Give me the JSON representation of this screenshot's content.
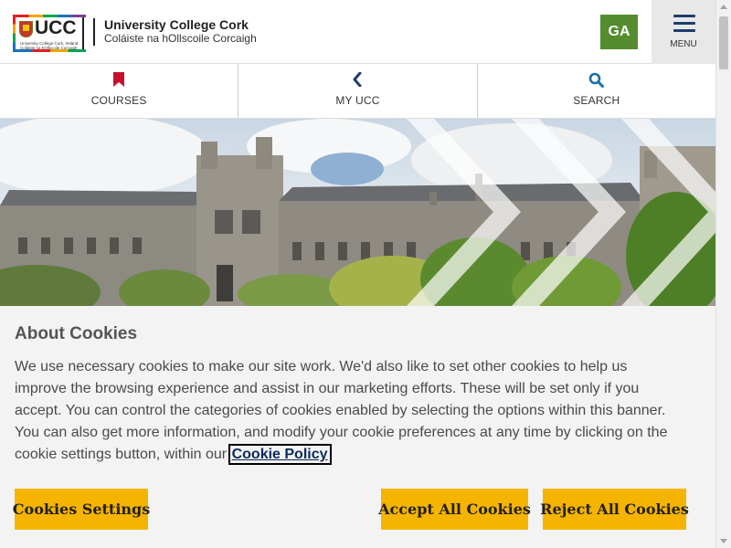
{
  "header": {
    "logo_text": "UCC",
    "logo_small_line1": "University College Cork, Ireland",
    "logo_small_line2": "Coláiste na hOllscoile Corcaigh",
    "site_name": "University College Cork",
    "site_name_irish": "Coláiste na hOllscoile Corcaigh",
    "language_button": "GA",
    "menu_label": "MENU"
  },
  "nav": {
    "items": [
      {
        "label": "COURSES",
        "icon": "bookmark-icon",
        "color": "#c8102e"
      },
      {
        "label": "MY UCC",
        "icon": "chevron-left-icon",
        "color": "#1f3c6e"
      },
      {
        "label": "SEARCH",
        "icon": "search-icon",
        "color": "#1d6fa8"
      }
    ]
  },
  "cookie_banner": {
    "title": "About Cookies",
    "body": "We use necessary cookies to make our site work. We'd also like to set other cookies to help us improve the browsing experience and assist in our marketing efforts. These will be set only if you accept. You can control the categories of cookies enabled by selecting the options within this banner. You can also get more information, and modify your cookie preferences at any time by clicking on the cookie settings button, within our",
    "policy_link": "Cookie Policy",
    "settings_button": "Cookies Settings",
    "accept_button": "Accept All Cookies",
    "reject_button": "Reject All Cookies"
  },
  "colors": {
    "accent_yellow": "#f5b400",
    "ga_green": "#548c2f",
    "navy": "#1f3c6e"
  }
}
